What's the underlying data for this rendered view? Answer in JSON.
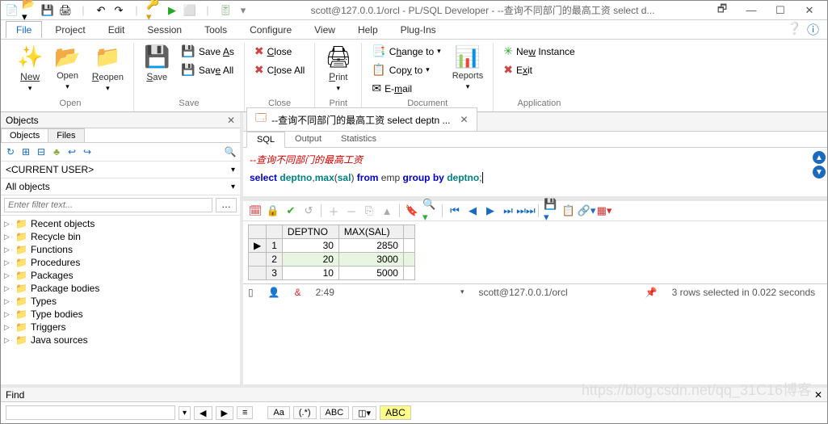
{
  "title": "scott@127.0.0.1/orcl - PL/SQL Developer - --查询不同部门的最高工资 select d...",
  "menubar": [
    "File",
    "Project",
    "Edit",
    "Session",
    "Tools",
    "Configure",
    "View",
    "Help",
    "Plug-Ins"
  ],
  "ribbon": {
    "open": {
      "new": "New",
      "open": "Open",
      "reopen": "Reopen",
      "label": "Open"
    },
    "save": {
      "save": "Save",
      "saveas": "Save As",
      "saveall": "Save All",
      "label": "Save"
    },
    "close": {
      "close": "Close",
      "closeall": "Close All",
      "label": "Close"
    },
    "print": {
      "print": "Print",
      "label": "Print"
    },
    "document": {
      "changeto": "Change to",
      "copyto": "Copy to",
      "email": "E-mail",
      "reports": "Reports",
      "label": "Document"
    },
    "application": {
      "newinst": "New Instance",
      "exit": "Exit",
      "label": "Application"
    }
  },
  "objects_panel": {
    "title": "Objects",
    "tabs": [
      "Objects",
      "Files"
    ],
    "current_user": "<CURRENT USER>",
    "all_objects": "All objects",
    "filter_placeholder": "Enter filter text...",
    "tree": [
      "Recent objects",
      "Recycle bin",
      "Functions",
      "Procedures",
      "Packages",
      "Package bodies",
      "Types",
      "Type bodies",
      "Triggers",
      "Java sources"
    ]
  },
  "doctab": {
    "title": "--查询不同部门的最高工资 select deptn ..."
  },
  "subtabs": [
    "SQL",
    "Output",
    "Statistics"
  ],
  "sql": {
    "comment": "--查询不同部门的最高工资",
    "line2_parts": {
      "select": "select",
      "sp1": " ",
      "deptno": "deptno",
      "c1": ",",
      "max": "max",
      "lp": "(",
      "sal": "sal",
      "rp": ")",
      "sp2": " ",
      "from": "from",
      "sp3": " ",
      "emp": "emp",
      "sp4": " ",
      "group": "group",
      "sp5": " ",
      "by": "by",
      "sp6": " ",
      "deptno2": "deptno",
      "semi": ";"
    }
  },
  "grid": {
    "headers": [
      "DEPTNO",
      "MAX(SAL)"
    ],
    "rows": [
      {
        "n": 1,
        "deptno": 30,
        "maxsal": 2850,
        "ptr": "▶"
      },
      {
        "n": 2,
        "deptno": 20,
        "maxsal": 3000,
        "hl": true
      },
      {
        "n": 3,
        "deptno": 10,
        "maxsal": 5000
      }
    ]
  },
  "status": {
    "pos": "2:49",
    "conn": "scott@127.0.0.1/orcl",
    "rows": "3 rows selected in 0.022 seconds"
  },
  "find": {
    "title": "Find",
    "abc": "ABC",
    "abc2": "ABC"
  },
  "watermark": "https://blog.csdn.net/qq_31C16博客"
}
